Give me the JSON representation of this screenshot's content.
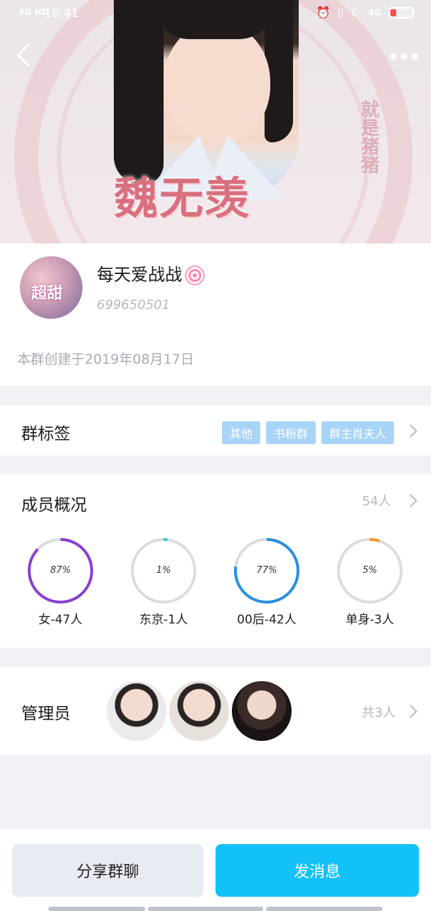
{
  "status_bar": {
    "signal": "4G HD",
    "time": "16:41",
    "network": "4G",
    "battery_level": 0.25
  },
  "hero": {
    "title": "魏无羡",
    "arc_text": "就是猪猪"
  },
  "profile": {
    "group_name": "每天爱战战",
    "group_id": "699650501",
    "avatar_text": "超甜",
    "created": "本群创建于2019年08月17日"
  },
  "tags_section": {
    "label": "群标签",
    "tags": [
      "其他",
      "书粉群",
      "群主肖夫人"
    ]
  },
  "members_section": {
    "label": "成员概况",
    "count": "54人",
    "stats": [
      {
        "pct_label": "87%",
        "value": 87,
        "label": "女-47人",
        "color": "#8a3fd1"
      },
      {
        "pct_label": "1%",
        "value": 1,
        "label": "东京-1人",
        "color": "#2bd3c0"
      },
      {
        "pct_label": "77%",
        "value": 77,
        "label": "00后-42人",
        "color": "#2a8fe0"
      },
      {
        "pct_label": "5%",
        "value": 5,
        "label": "单身-3人",
        "color": "#f29a2e"
      }
    ]
  },
  "admins_section": {
    "label": "管理员",
    "total": "共3人"
  },
  "actions": {
    "share": "分享群聊",
    "send": "发消息"
  }
}
